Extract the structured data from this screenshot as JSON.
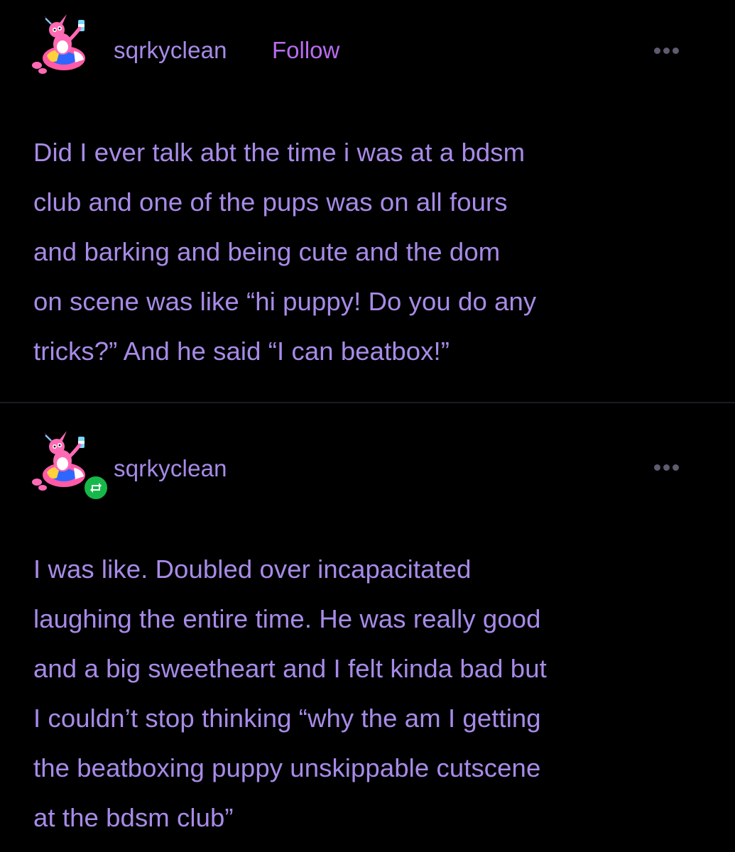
{
  "posts": [
    {
      "username": "sqrkyclean",
      "follow_label": "Follow",
      "more_icon": "ellipsis-icon",
      "avatar_icon": "bunny-avatar-icon",
      "body": "Did I ever talk abt the time i was at a bdsm\nclub and one of the pups was on all fours\nand barking and being cute and the dom\non scene was like “hi puppy! Do you do any\ntricks?” And he said “I can beatbox!”"
    },
    {
      "username": "sqrkyclean",
      "more_icon": "ellipsis-icon",
      "avatar_icon": "bunny-avatar-icon",
      "badge_icon": "reblog-icon",
      "body": "I was like. Doubled over incapacitated\nlaughing the entire time. He was really good\nand a big sweetheart and I felt kinda bad but\nI couldn’t stop thinking “why the am I getting\nthe beatboxing puppy unskippable cutscene\nat the bdsm club”"
    }
  ],
  "colors": {
    "background": "#000000",
    "text": "#a78be8",
    "follow": "#b86cf0",
    "more_dots": "#5f5a6d",
    "reblog_badge": "#17b84a",
    "divider": "#1c1a22"
  }
}
